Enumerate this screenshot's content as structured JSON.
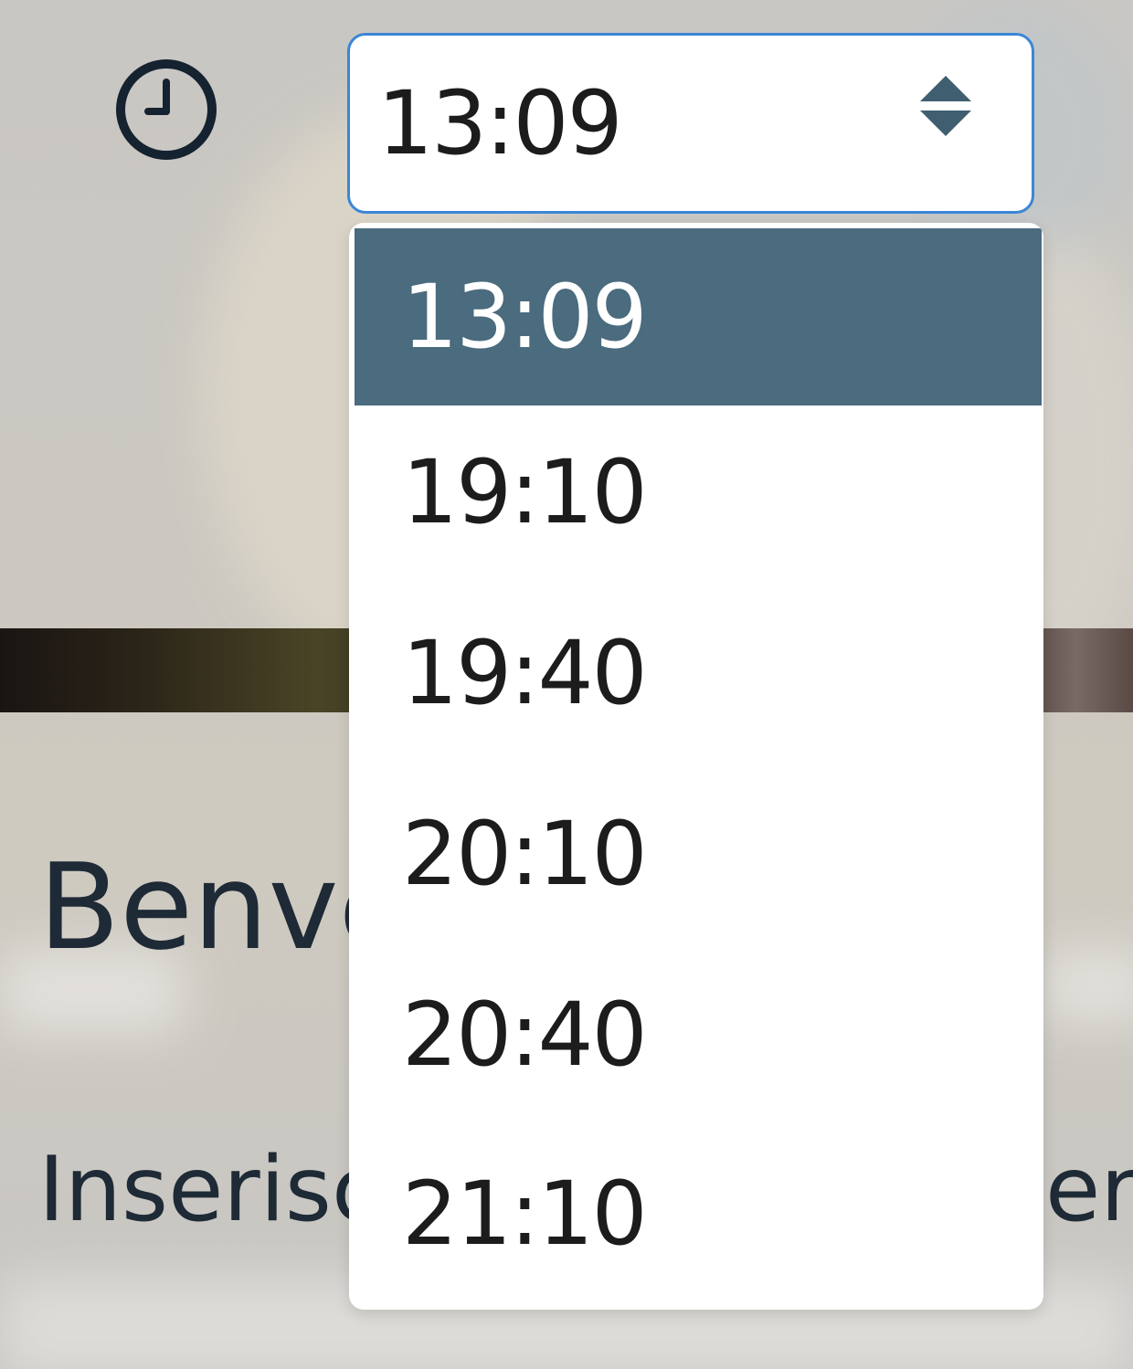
{
  "header": {
    "clock_icon": "clock-icon",
    "time_select": {
      "value": "13:09",
      "arrows_icon": "sort-arrows-icon",
      "accent_color": "#3b86d6"
    }
  },
  "dropdown": {
    "selected_color": "#4b6b7e",
    "options": [
      {
        "label": "13:09",
        "selected": true
      },
      {
        "label": "19:10",
        "selected": false
      },
      {
        "label": "19:40",
        "selected": false
      },
      {
        "label": "20:10",
        "selected": false
      },
      {
        "label": "20:40",
        "selected": false
      },
      {
        "label": "21:10",
        "selected": false
      }
    ]
  },
  "main": {
    "welcome_text": "Benve",
    "sub_text": "Inserisc",
    "sub_text_tail": "ers"
  }
}
